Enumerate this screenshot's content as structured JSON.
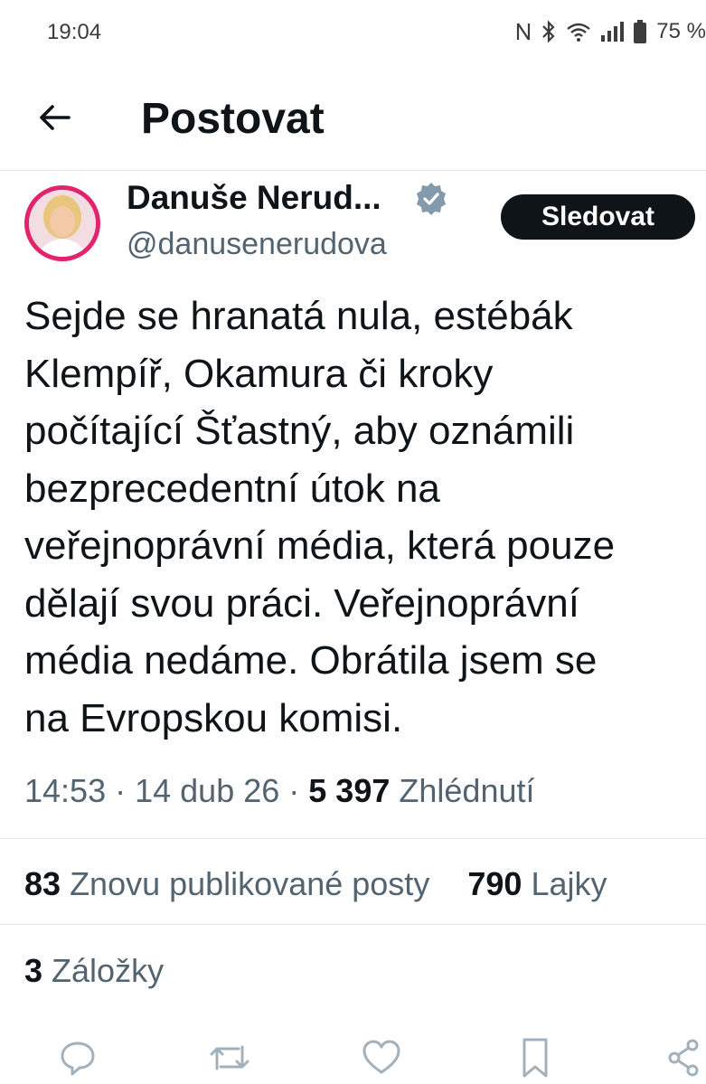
{
  "status_bar": {
    "time": "19:04",
    "icons": [
      "nfc-icon",
      "bluetooth-icon",
      "wifi-icon",
      "signal-icon",
      "battery-icon"
    ],
    "battery": "75 %"
  },
  "header": {
    "back_icon": "arrow-left-icon",
    "title": "Postovat"
  },
  "post": {
    "author": {
      "name": "Danuše Nerud...",
      "handle": "@danusenerudova",
      "verified": true,
      "avatar_ring_color": "#e2246f"
    },
    "follow_label": "Sledovat",
    "text_lines": [
      "Sejde se hranatá nula, estébák",
      "Klempíř, Okamura či kroky",
      "počítající Šťastný, aby oznámili",
      "bezprecedentní útok na",
      "veřejnoprávní média, která pouze",
      "dělají svou práci. Veřejnoprávní",
      "média nedáme. Obrátila jsem se",
      "na Evropskou komisi."
    ],
    "meta": {
      "time": "14:53",
      "date": "14 dub 26",
      "views_count": "5 397",
      "views_label": "Zhlédnutí"
    },
    "stats": {
      "reposts_count": "83",
      "reposts_label": "Znovu publikované posty",
      "likes_count": "790",
      "likes_label": "Lajky",
      "bookmarks_count": "3",
      "bookmarks_label": "Záložky"
    }
  },
  "action_bar": [
    "reply-icon",
    "repost-icon",
    "like-icon",
    "bookmark-icon",
    "share-icon"
  ],
  "colors": {
    "text": "#0f1419",
    "secondary": "#536471",
    "divider": "#e1e6ea",
    "verified": "#829aab",
    "follow_button": "#0f1419"
  }
}
